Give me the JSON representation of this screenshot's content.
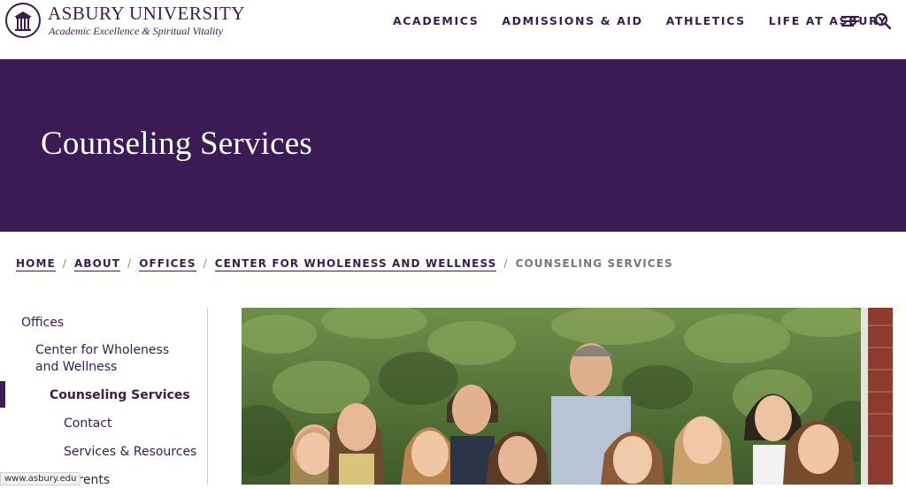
{
  "header": {
    "logo_name": "ASBURY UNIVERSITY",
    "logo_tagline": "Academic Excellence & Spiritual Vitality",
    "nav": [
      "ACADEMICS",
      "ADMISSIONS & AID",
      "ATHLETICS",
      "LIFE AT ASBURY"
    ],
    "menu_icon": "hamburger-menu-icon",
    "search_icon": "search-icon"
  },
  "hero": {
    "title": "Counseling Services"
  },
  "breadcrumb": {
    "items": [
      "HOME",
      "ABOUT",
      "OFFICES",
      "CENTER FOR WHOLENESS AND WELLNESS"
    ],
    "current": "COUNSELING SERVICES",
    "separator": "/"
  },
  "sidebar": {
    "items": [
      {
        "label": "Offices"
      },
      {
        "label": "Center for Wholeness and Wellness"
      },
      {
        "label": "Counseling Services"
      },
      {
        "label": "Contact"
      },
      {
        "label": "Services & Resources"
      },
      {
        "label": "Parents"
      }
    ]
  },
  "status_url": "www.asbury.edu",
  "colors": {
    "brand_purple": "#3b1b53",
    "text_purple": "#3a1c4f",
    "breadcrumb_current": "#777777"
  }
}
